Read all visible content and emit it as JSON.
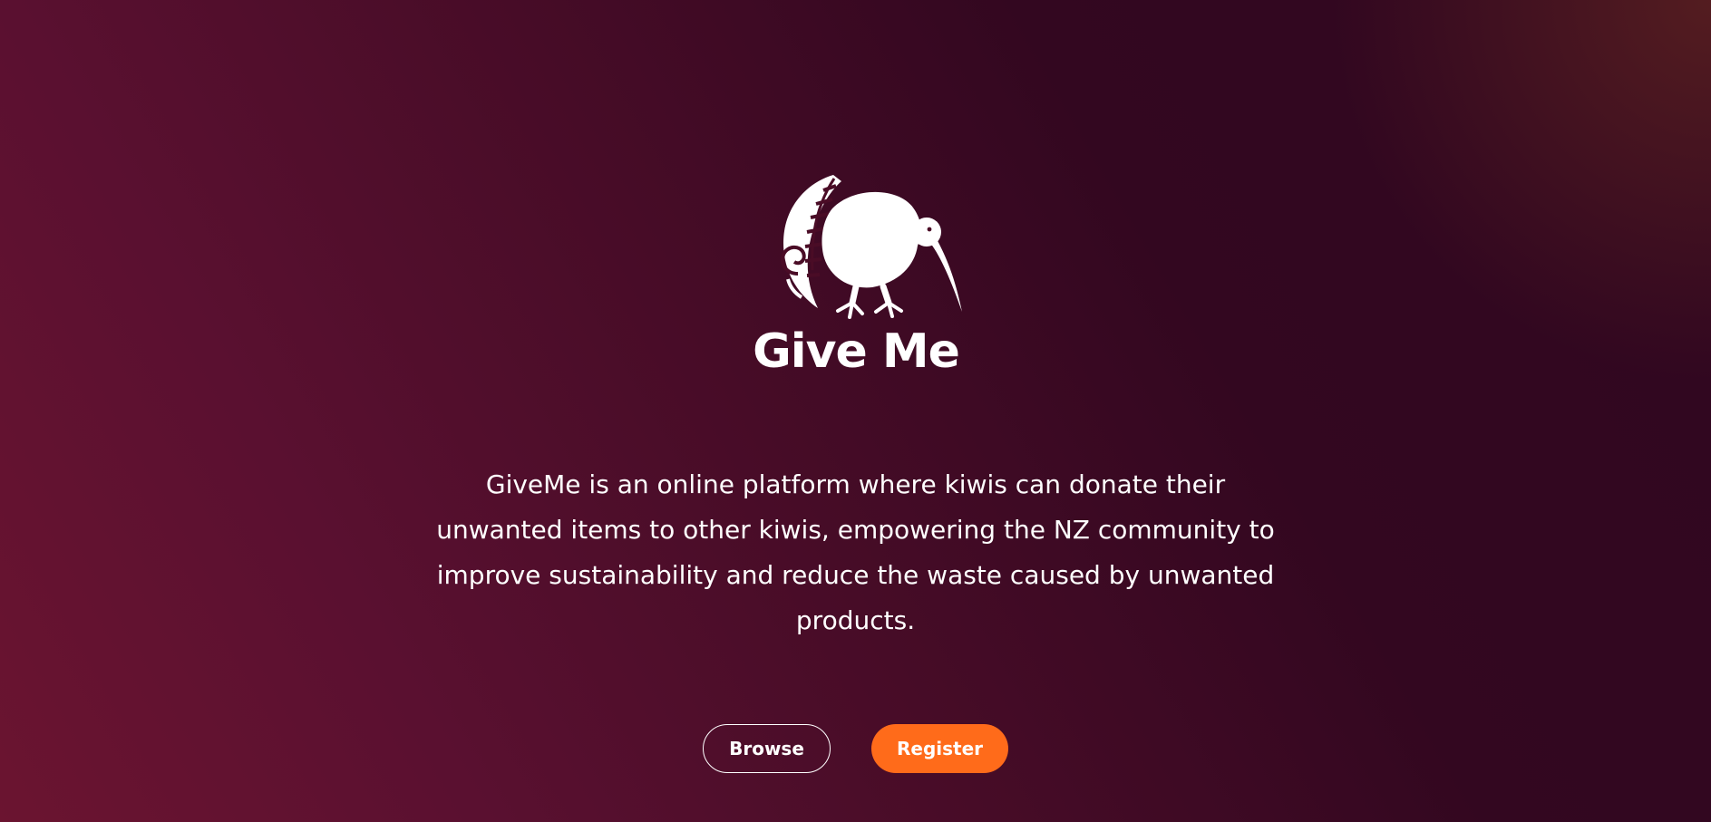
{
  "brand": {
    "logo_icon": "kiwi-bird-with-fern-icon",
    "logo_text": "Give Me"
  },
  "hero": {
    "description": "GiveMe is an online platform where kiwis can donate their unwanted items to other kiwis, empowering the NZ community to improve sustainability and reduce the waste caused by unwanted products."
  },
  "actions": {
    "browse_label": "Browse",
    "register_label": "Register"
  },
  "colors": {
    "background_start": "#6b1430",
    "background_end": "#300720",
    "accent": "#ff6b1a",
    "text": "#ffffff"
  }
}
